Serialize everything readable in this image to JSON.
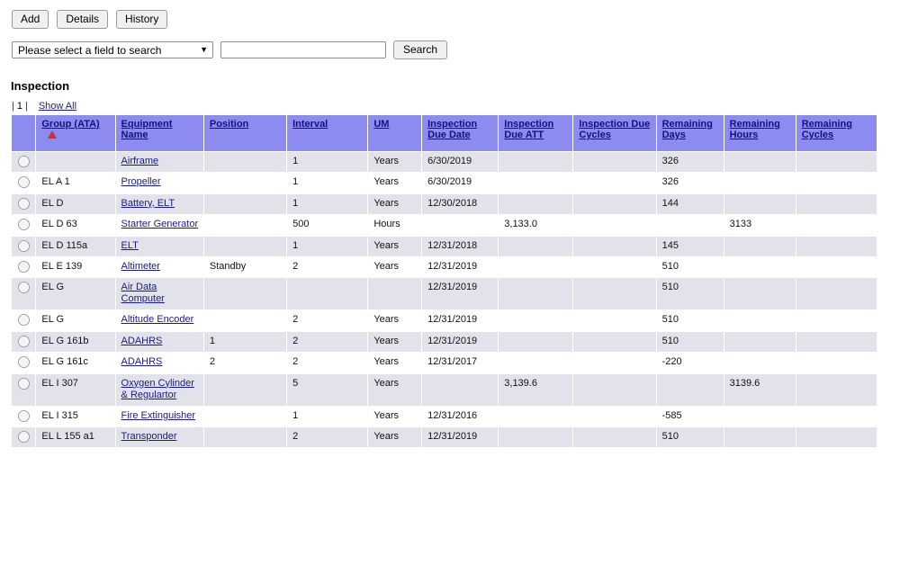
{
  "toolbar": {
    "buttons": [
      {
        "label": "Add",
        "name": "add-button"
      },
      {
        "label": "Details",
        "name": "details-button"
      },
      {
        "label": "History",
        "name": "history-button"
      }
    ]
  },
  "search": {
    "field_select_value": "Please select a field to search",
    "caret_glyph": "▼",
    "input_value": "",
    "input_placeholder": "",
    "button_label": "Search"
  },
  "section": {
    "title": "Inspection"
  },
  "pager": {
    "left_sep": "|",
    "page": "1",
    "right_sep": "|",
    "show_all_label": "Show All"
  },
  "grid": {
    "sort_indicator": "ascending",
    "accent_header_bg": "#8c8cf0",
    "accent_link": "#1a1a8c",
    "sort_arrow_color": "#d32f2f",
    "row_stripe_bg": "#e2e2ea",
    "columns": [
      {
        "label": "",
        "name": "select",
        "sorted": false
      },
      {
        "label": "Group (ATA)",
        "name": "group-ata",
        "sorted": true
      },
      {
        "label": "Equipment Name",
        "name": "equipment-name",
        "sorted": false
      },
      {
        "label": "Position",
        "name": "position",
        "sorted": false
      },
      {
        "label": "Interval",
        "name": "interval",
        "sorted": false
      },
      {
        "label": "UM",
        "name": "um",
        "sorted": false
      },
      {
        "label": "Inspection Due Date",
        "name": "insp-due-date",
        "sorted": false
      },
      {
        "label": "Inspection Due ATT",
        "name": "insp-due-att",
        "sorted": false
      },
      {
        "label": "Inspection Due Cycles",
        "name": "insp-due-cycles",
        "sorted": false
      },
      {
        "label": "Remaining Days",
        "name": "remaining-days",
        "sorted": false
      },
      {
        "label": "Remaining Hours",
        "name": "remaining-hours",
        "sorted": false
      },
      {
        "label": "Remaining Cycles",
        "name": "remaining-cycles",
        "sorted": false
      }
    ],
    "rows": [
      {
        "group": "",
        "equipment": "Airframe",
        "position": "",
        "interval": "1",
        "um": "Years",
        "due_date": "6/30/2019",
        "due_att": "",
        "due_cycles": "",
        "rem_days": "326",
        "rem_hours": "",
        "rem_cycles": ""
      },
      {
        "group": "EL A 1",
        "equipment": "Propeller",
        "position": "",
        "interval": "1",
        "um": "Years",
        "due_date": "6/30/2019",
        "due_att": "",
        "due_cycles": "",
        "rem_days": "326",
        "rem_hours": "",
        "rem_cycles": ""
      },
      {
        "group": "EL D",
        "equipment": "Battery, ELT",
        "position": "",
        "interval": "1",
        "um": "Years",
        "due_date": "12/30/2018",
        "due_att": "",
        "due_cycles": "",
        "rem_days": "144",
        "rem_hours": "",
        "rem_cycles": ""
      },
      {
        "group": "EL D 63",
        "equipment": "Starter Generator",
        "position": "",
        "interval": "500",
        "um": "Hours",
        "due_date": "",
        "due_att": "3,133.0",
        "due_cycles": "",
        "rem_days": "",
        "rem_hours": "3133",
        "rem_cycles": ""
      },
      {
        "group": "EL D 115a",
        "equipment": "ELT",
        "position": "",
        "interval": "1",
        "um": "Years",
        "due_date": "12/31/2018",
        "due_att": "",
        "due_cycles": "",
        "rem_days": "145",
        "rem_hours": "",
        "rem_cycles": ""
      },
      {
        "group": "EL E 139",
        "equipment": "Altimeter",
        "position": "Standby",
        "interval": "2",
        "um": "Years",
        "due_date": "12/31/2019",
        "due_att": "",
        "due_cycles": "",
        "rem_days": "510",
        "rem_hours": "",
        "rem_cycles": ""
      },
      {
        "group": "EL G",
        "equipment": "Air Data Computer",
        "position": "",
        "interval": "",
        "um": "",
        "due_date": "12/31/2019",
        "due_att": "",
        "due_cycles": "",
        "rem_days": "510",
        "rem_hours": "",
        "rem_cycles": ""
      },
      {
        "group": "EL G",
        "equipment": "Altitude Encoder",
        "position": "",
        "interval": "2",
        "um": "Years",
        "due_date": "12/31/2019",
        "due_att": "",
        "due_cycles": "",
        "rem_days": "510",
        "rem_hours": "",
        "rem_cycles": ""
      },
      {
        "group": "EL G 161b",
        "equipment": "ADAHRS",
        "position": "1",
        "interval": "2",
        "um": "Years",
        "due_date": "12/31/2019",
        "due_att": "",
        "due_cycles": "",
        "rem_days": "510",
        "rem_hours": "",
        "rem_cycles": ""
      },
      {
        "group": "EL G 161c",
        "equipment": "ADAHRS",
        "position": "2",
        "interval": "2",
        "um": "Years",
        "due_date": "12/31/2017",
        "due_att": "",
        "due_cycles": "",
        "rem_days": "-220",
        "rem_hours": "",
        "rem_cycles": ""
      },
      {
        "group": "EL I 307",
        "equipment": "Oxygen Cylinder & Regulartor",
        "position": "",
        "interval": "5",
        "um": "Years",
        "due_date": "",
        "due_att": "3,139.6",
        "due_cycles": "",
        "rem_days": "",
        "rem_hours": "3139.6",
        "rem_cycles": ""
      },
      {
        "group": "EL I 315",
        "equipment": "Fire Extinguisher",
        "position": "",
        "interval": "1",
        "um": "Years",
        "due_date": "12/31/2016",
        "due_att": "",
        "due_cycles": "",
        "rem_days": "-585",
        "rem_hours": "",
        "rem_cycles": ""
      },
      {
        "group": "EL L 155 a1",
        "equipment": "Transponder",
        "position": "",
        "interval": "2",
        "um": "Years",
        "due_date": "12/31/2019",
        "due_att": "",
        "due_cycles": "",
        "rem_days": "510",
        "rem_hours": "",
        "rem_cycles": ""
      }
    ]
  }
}
